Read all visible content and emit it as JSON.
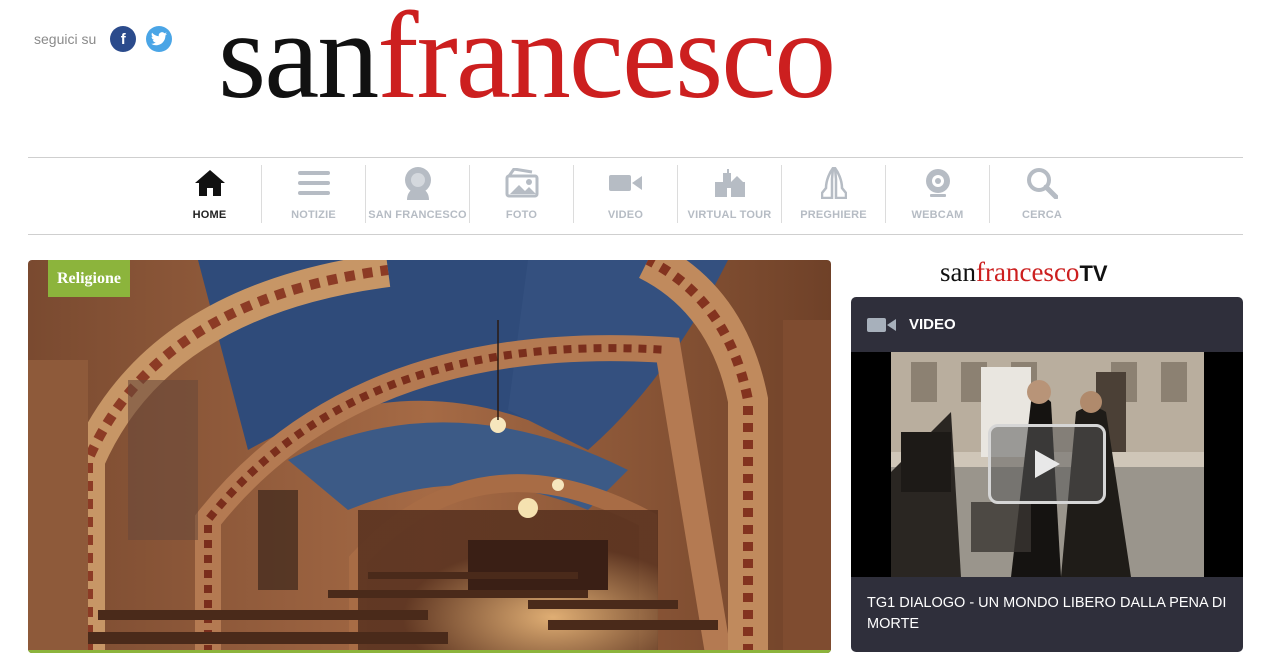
{
  "social": {
    "label": "seguici su",
    "facebook_glyph": "f",
    "twitter_glyph": "t",
    "icons": [
      "facebook-icon",
      "twitter-icon"
    ],
    "colors": {
      "facebook": "#2b4b8c",
      "twitter": "#4aa5e6"
    }
  },
  "logo": {
    "part1": "san",
    "part2": "francesco",
    "colors": {
      "dark": "#111111",
      "accent": "#cc1f1f"
    }
  },
  "nav": {
    "items": [
      {
        "label": "HOME",
        "icon": "home-icon",
        "active": true
      },
      {
        "label": "NOTIZIE",
        "icon": "menu-icon",
        "active": false
      },
      {
        "label": "SAN FRANCESCO",
        "icon": "saint-icon",
        "active": false
      },
      {
        "label": "FOTO",
        "icon": "photo-icon",
        "active": false
      },
      {
        "label": "VIDEO",
        "icon": "video-camera-icon",
        "active": false
      },
      {
        "label": "VIRTUAL TOUR",
        "icon": "basilica-icon",
        "active": false
      },
      {
        "label": "PREGHIERE",
        "icon": "praying-hands-icon",
        "active": false
      },
      {
        "label": "WEBCAM",
        "icon": "webcam-icon",
        "active": false
      },
      {
        "label": "CERCA",
        "icon": "search-icon",
        "active": false
      }
    ]
  },
  "hero": {
    "badge": "Religione",
    "badge_color": "#8cb43c"
  },
  "tv": {
    "logo_part1": "san",
    "logo_part2": "francesco",
    "logo_part3": "TV",
    "section_title": "VIDEO",
    "section_icon": "video-camera-icon",
    "caption": "TG1 DIALOGO - UN MONDO LIBERO DALLA PENA DI MORTE",
    "box_color": "#2f2f3b"
  }
}
